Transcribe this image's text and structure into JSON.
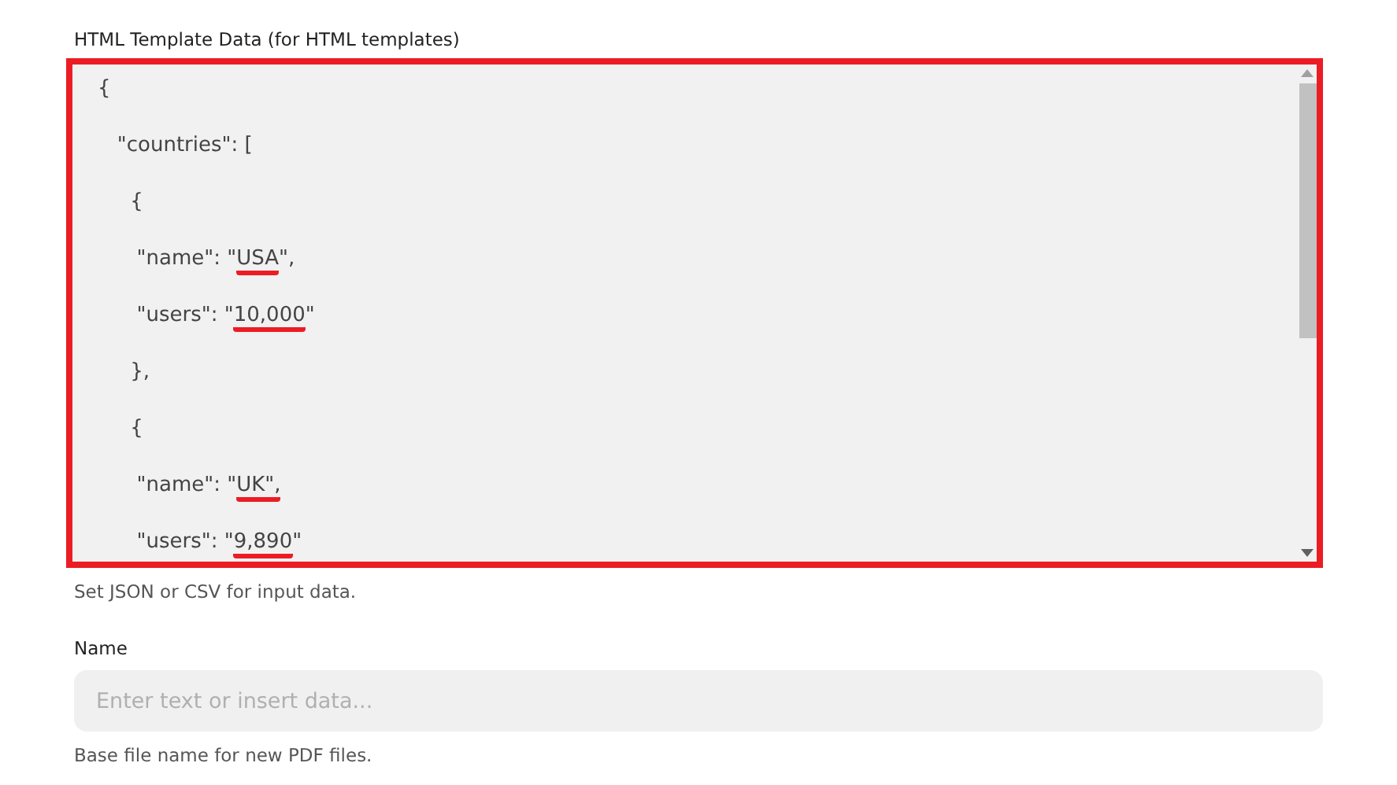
{
  "template_data": {
    "label": "HTML Template Data (for HTML templates)",
    "highlighted": true,
    "lines": [
      {
        "segments": [
          {
            "text": "{",
            "underlined": false
          }
        ]
      },
      {
        "segments": [
          {
            "text": "   \"countries\": [",
            "underlined": false
          }
        ]
      },
      {
        "segments": [
          {
            "text": "     {",
            "underlined": false
          }
        ]
      },
      {
        "segments": [
          {
            "text": "      \"name\": \"",
            "underlined": false
          },
          {
            "text": "USA",
            "underlined": true
          },
          {
            "text": "\",",
            "underlined": false
          }
        ]
      },
      {
        "segments": [
          {
            "text": "      \"users\": \"",
            "underlined": false
          },
          {
            "text": "10,000",
            "underlined": true
          },
          {
            "text": "\"",
            "underlined": false
          }
        ]
      },
      {
        "segments": [
          {
            "text": "     },",
            "underlined": false
          }
        ]
      },
      {
        "segments": [
          {
            "text": "     {",
            "underlined": false
          }
        ]
      },
      {
        "segments": [
          {
            "text": "      \"name\": \"",
            "underlined": false
          },
          {
            "text": "UK\",",
            "underlined": true
          }
        ]
      },
      {
        "segments": [
          {
            "text": "      \"users\": \"",
            "underlined": false
          },
          {
            "text": "9,890",
            "underlined": true
          },
          {
            "text": "\"",
            "underlined": false
          }
        ]
      }
    ],
    "help": "Set JSON or CSV for input data."
  },
  "name_field": {
    "label": "Name",
    "placeholder": "Enter text or insert data...",
    "help": "Base file name for new PDF files."
  }
}
